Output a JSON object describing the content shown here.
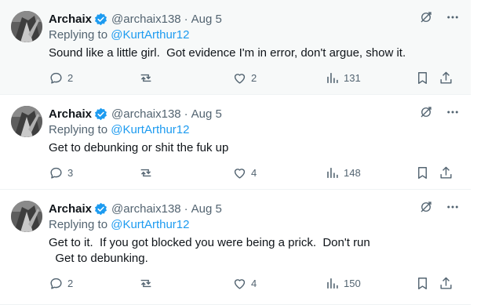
{
  "colors": {
    "accent": "#1d9bf0",
    "secondary_text": "#536471",
    "primary_text": "#0f1419",
    "hover_bg": "#f7f9f9"
  },
  "tweets": [
    {
      "display_name": "Archaix",
      "verified": true,
      "handle": "@archaix138",
      "separator": "·",
      "date": "Aug 5",
      "replying_prefix": "Replying to ",
      "replying_to": "@KurtArthur12",
      "text": "Sound like a little girl.  Got evidence I'm in error, don't argue, show it.",
      "replies": "2",
      "reposts": "",
      "likes": "2",
      "views": "131"
    },
    {
      "display_name": "Archaix",
      "verified": true,
      "handle": "@archaix138",
      "separator": "·",
      "date": "Aug 5",
      "replying_prefix": "Replying to ",
      "replying_to": "@KurtArthur12",
      "text": "Get to debunking or shit the fuk up",
      "replies": "3",
      "reposts": "",
      "likes": "4",
      "views": "148"
    },
    {
      "display_name": "Archaix",
      "verified": true,
      "handle": "@archaix138",
      "separator": "·",
      "date": "Aug 5",
      "replying_prefix": "Replying to ",
      "replying_to": "@KurtArthur12",
      "text": "Get to it.  If you got blocked you were being a prick.  Don't run\n  Get to debunking.",
      "replies": "2",
      "reposts": "",
      "likes": "4",
      "views": "150"
    }
  ],
  "icons": {
    "verified": "verified-badge-icon",
    "grok": "grok-icon",
    "more": "more-icon",
    "reply": "reply-icon",
    "repost": "repost-icon",
    "like": "heart-icon",
    "views": "views-icon",
    "bookmark": "bookmark-icon",
    "share": "share-icon"
  }
}
